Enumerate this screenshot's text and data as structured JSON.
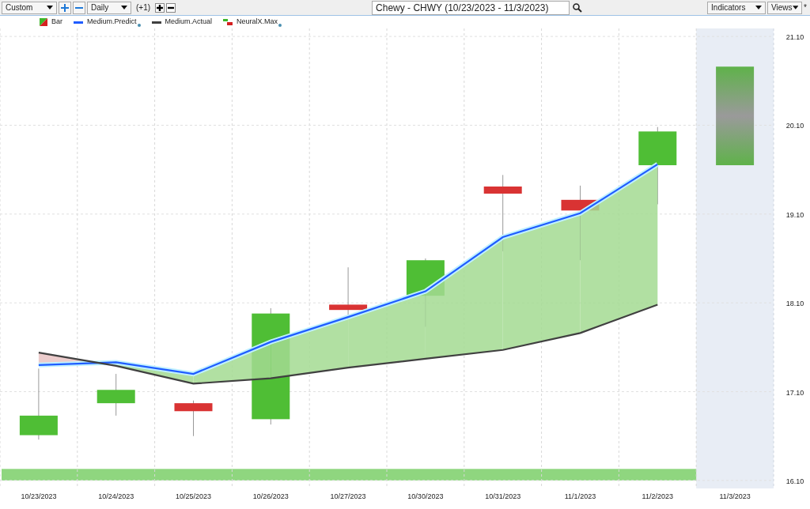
{
  "toolbar": {
    "preset": "Custom",
    "interval": "Daily",
    "offset": "(+1)",
    "title": "Chewy - CHWY (10/23/2023 - 11/3/2023)",
    "indicators": "Indicators",
    "views": "Views",
    "modified_mark": "*"
  },
  "legend": [
    {
      "kind": "bar",
      "label": "Bar",
      "dot": false
    },
    {
      "kind": "series",
      "dot": true
    },
    {
      "kind": "series",
      "dot": false
    },
    {
      "kind": "step",
      "label": "NeuralX.Max",
      "dot": true
    }
  ],
  "chart": {
    "chart_data": {
      "type": "line",
      "grid": true,
      "categories": [
        "10/23/2023",
        "10/24/2023",
        "10/25/2023",
        "10/26/2023",
        "10/27/2023",
        "10/30/2023",
        "10/31/2023",
        "11/1/2023",
        "11/2/2023",
        "11/3/2023"
      ],
      "series": [
        {
          "name": "Medium.Predict",
          "color": "#1f5cff",
          "values": [
            17.4,
            17.43,
            17.3,
            17.66,
            17.94,
            18.23,
            18.84,
            19.11,
            19.66,
            null
          ]
        },
        {
          "name": "Medium.Actual",
          "color": "#404040",
          "values": [
            17.54,
            17.39,
            17.19,
            17.25,
            17.37,
            17.47,
            17.57,
            17.76,
            18.08,
            null
          ]
        }
      ],
      "bands": [
        {
          "axis": "x",
          "from": "11/3/2023",
          "to": "11/3/2023",
          "color": "#e8edf5"
        },
        {
          "axis": "y",
          "from": 16.1,
          "to": 16.23,
          "color": "#8fd67f"
        }
      ],
      "ylim": [
        16.01,
        21.19
      ],
      "yticks": [
        {
          "value": 21.1,
          "label": "21.10"
        },
        {
          "value": 20.1,
          "label": "20.10"
        },
        {
          "value": 19.1,
          "label": "19.10"
        },
        {
          "value": 18.1,
          "label": "18.10"
        },
        {
          "value": 17.1,
          "label": "17.10"
        },
        {
          "value": 16.1,
          "label": "16.10"
        }
      ]
    }
  }
}
